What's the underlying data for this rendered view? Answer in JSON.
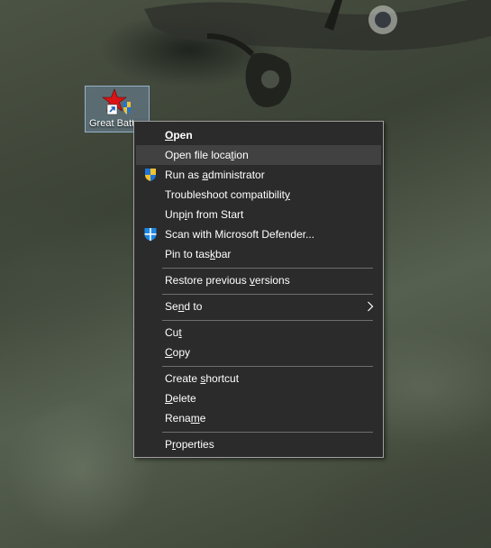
{
  "desktop": {
    "icon_label": "Great Batt"
  },
  "menu": {
    "items": [
      {
        "pre": "",
        "acc": "O",
        "post": "pen"
      },
      {
        "pre": "Open file loca",
        "acc": "t",
        "post": "ion"
      },
      {
        "pre": "Run as ",
        "acc": "a",
        "post": "dministrator"
      },
      {
        "pre": "Troubleshoot compatibilit",
        "acc": "y",
        "post": ""
      },
      {
        "pre": "Unp",
        "acc": "i",
        "post": "n from Start"
      },
      {
        "pre": "Scan with Microsoft Defender...",
        "acc": "",
        "post": ""
      },
      {
        "pre": "Pin to tas",
        "acc": "k",
        "post": "bar"
      },
      {
        "pre": "Restore previous ",
        "acc": "v",
        "post": "ersions"
      },
      {
        "pre": "Se",
        "acc": "n",
        "post": "d to"
      },
      {
        "pre": "Cu",
        "acc": "t",
        "post": ""
      },
      {
        "pre": "",
        "acc": "C",
        "post": "opy"
      },
      {
        "pre": "Create ",
        "acc": "s",
        "post": "hortcut"
      },
      {
        "pre": "",
        "acc": "D",
        "post": "elete"
      },
      {
        "pre": "Rena",
        "acc": "m",
        "post": "e"
      },
      {
        "pre": "P",
        "acc": "r",
        "post": "operties"
      }
    ]
  },
  "icons": {
    "uac_shield": "uac-shield-icon",
    "defender": "defender-icon",
    "submenu_arrow": "chevron-right-icon",
    "shortcut_arrow": "shortcut-arrow-icon"
  },
  "colors": {
    "menu_bg": "#2b2b2b",
    "menu_hover": "#414141",
    "menu_border": "#a0a0a0",
    "separator": "#6e6e6e",
    "text": "#ffffff"
  }
}
